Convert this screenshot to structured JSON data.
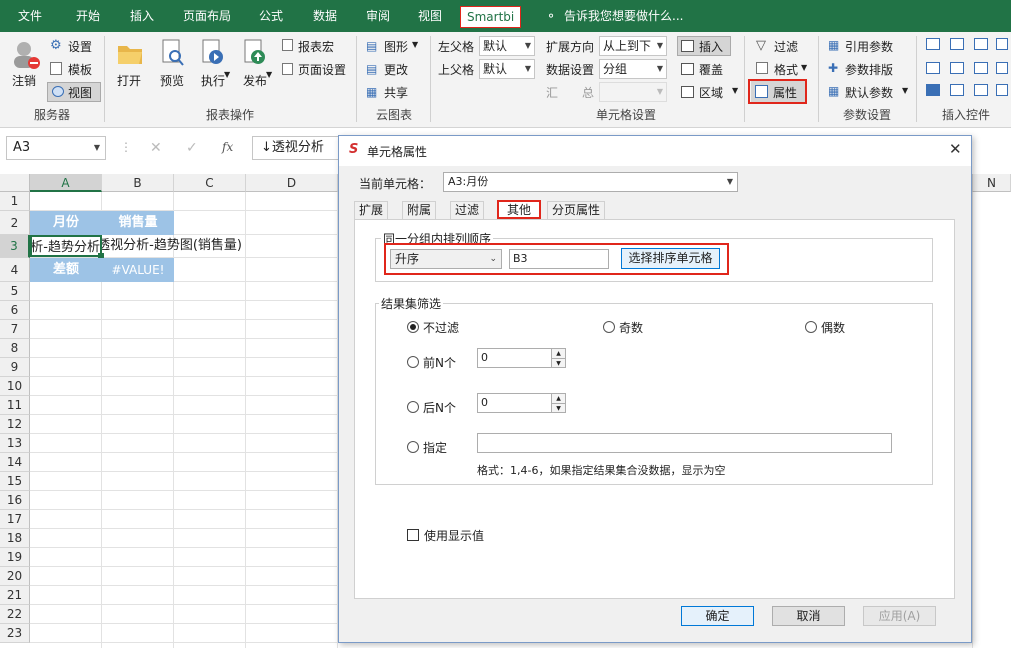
{
  "menubar": {
    "tabs": [
      "文件",
      "开始",
      "插入",
      "页面布局",
      "公式",
      "数据",
      "审阅",
      "视图",
      "Smartbi"
    ],
    "tell_me": "告诉我您想要做什么..."
  },
  "ribbon": {
    "server": {
      "logout": "注销",
      "settings": "设置",
      "template": "模板",
      "view": "视图",
      "group": "服务器"
    },
    "report_ops": {
      "open": "打开",
      "preview": "预览",
      "execute": "执行",
      "publish": "发布",
      "macro": "报表宏",
      "page_setup": "页面设置",
      "group": "报表操作"
    },
    "cloud_chart": {
      "graphic": "图形",
      "change": "更改",
      "share": "共享",
      "group": "云图表"
    },
    "cell_settings": {
      "left_parent": "左父格",
      "left_parent_val": "默认",
      "top_parent": "上父格",
      "top_parent_val": "默认",
      "expand_dir": "扩展方向",
      "expand_dir_val": "从上到下",
      "data_setting": "数据设置",
      "data_setting_val": "分组",
      "summary": "汇　　总",
      "insert": "插入",
      "cover": "覆盖",
      "area": "区域",
      "group": "单元格设置"
    },
    "filter_group": {
      "filter": "过滤",
      "format": "格式",
      "property": "属性"
    },
    "params": {
      "ref_param": "引用参数",
      "param_layout": "参数排版",
      "default_param": "默认参数",
      "group": "参数设置"
    },
    "controls": {
      "group": "插入控件"
    }
  },
  "formula_bar": {
    "name_box": "A3",
    "fx": "fx",
    "content": "↓透视分析"
  },
  "grid": {
    "columns": [
      "A",
      "B",
      "C",
      "D",
      "N"
    ],
    "rows": [
      "1",
      "2",
      "3",
      "4",
      "5",
      "6",
      "7",
      "8",
      "9",
      "10",
      "11",
      "12",
      "13",
      "14",
      "15",
      "16",
      "17",
      "18",
      "19",
      "20",
      "21",
      "22",
      "23"
    ],
    "cells": {
      "a2": "月份",
      "b2": "销售量",
      "a3": "透视分析-趋势分析",
      "b3": "透视分析-趋势图(销售量)",
      "a4": "差额",
      "b4": "#VALUE!"
    }
  },
  "dialog": {
    "title": "单元格属性",
    "current_cell_label": "当前单元格：",
    "current_cell_value": "A3:月份",
    "tabs": [
      "扩展",
      "附属",
      "过滤",
      "其他",
      "分页属性"
    ],
    "sort_group": {
      "legend": "同一分组内排列顺序",
      "order_value": "升序",
      "cell_value": "B3",
      "select_button": "选择排序单元格"
    },
    "filter_group": {
      "legend": "结果集筛选",
      "no_filter": "不过滤",
      "odd": "奇数",
      "even": "偶数",
      "first_n": "前N个",
      "first_n_val": "0",
      "last_n": "后N个",
      "last_n_val": "0",
      "specify": "指定",
      "hint": "格式：1,4-6，如果指定结果集合没数据，显示为空"
    },
    "use_display_value": "使用显示值",
    "buttons": {
      "ok": "确定",
      "cancel": "取消",
      "apply": "应用(A)"
    }
  }
}
